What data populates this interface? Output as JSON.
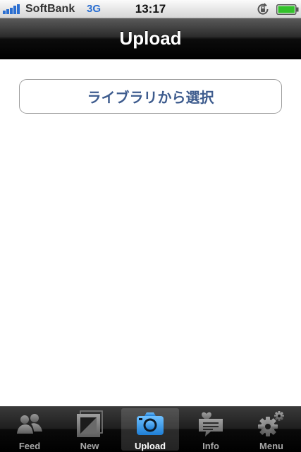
{
  "status_bar": {
    "carrier": "SoftBank",
    "network": "3G",
    "time": "13:17",
    "icons": [
      "signal-icon",
      "rotation-lock-icon",
      "battery-icon"
    ]
  },
  "nav": {
    "title": "Upload"
  },
  "main": {
    "library_button_label": "ライブラリから選択"
  },
  "tabs": [
    {
      "label": "Feed",
      "icon": "people-icon",
      "selected": false
    },
    {
      "label": "New",
      "icon": "photo-frame-icon",
      "selected": false
    },
    {
      "label": "Upload",
      "icon": "camera-icon",
      "selected": true
    },
    {
      "label": "Info",
      "icon": "chat-bubble-icon",
      "selected": false
    },
    {
      "label": "Menu",
      "icon": "gear-icon",
      "selected": false
    }
  ],
  "colors": {
    "network": "#2a6ed1",
    "button_text": "#3e5c8e",
    "tab_selected_icon": "#3b9be8"
  }
}
